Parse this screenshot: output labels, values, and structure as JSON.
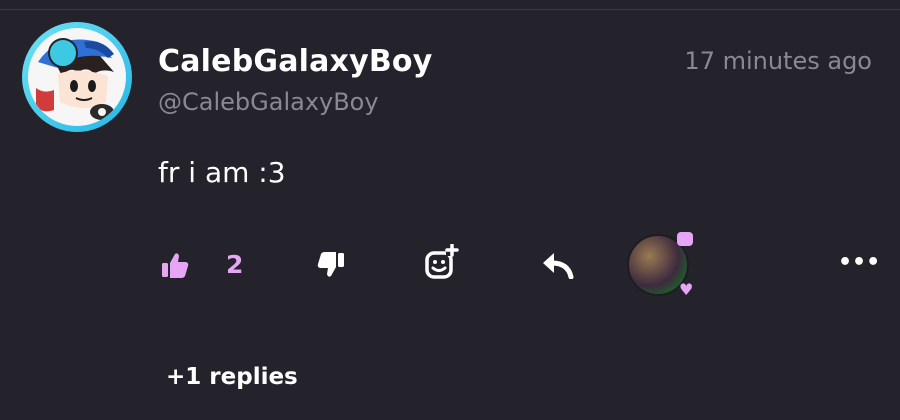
{
  "comment": {
    "author": {
      "display_name": "CalebGalaxyBoy",
      "handle": "@CalebGalaxyBoy",
      "avatar_icon": "cartoon-avatar"
    },
    "timestamp": "17 minutes ago",
    "message": "fr i am :3"
  },
  "actions": {
    "like_icon": "thumbs-up-icon",
    "like_count": "2",
    "dislike_icon": "thumbs-down-icon",
    "add_reaction_icon": "smiley-plus-icon",
    "reply_icon": "reply-arrow-icon",
    "more_icon": "ellipsis-icon",
    "more_glyph": "•••",
    "reaction_heart": "♥"
  },
  "replies": {
    "label": "+1 replies"
  },
  "colors": {
    "background": "#24222a",
    "accent_pink": "#e6a6f5",
    "muted_text": "#8a8890",
    "avatar_ring": "#24b6e6"
  }
}
